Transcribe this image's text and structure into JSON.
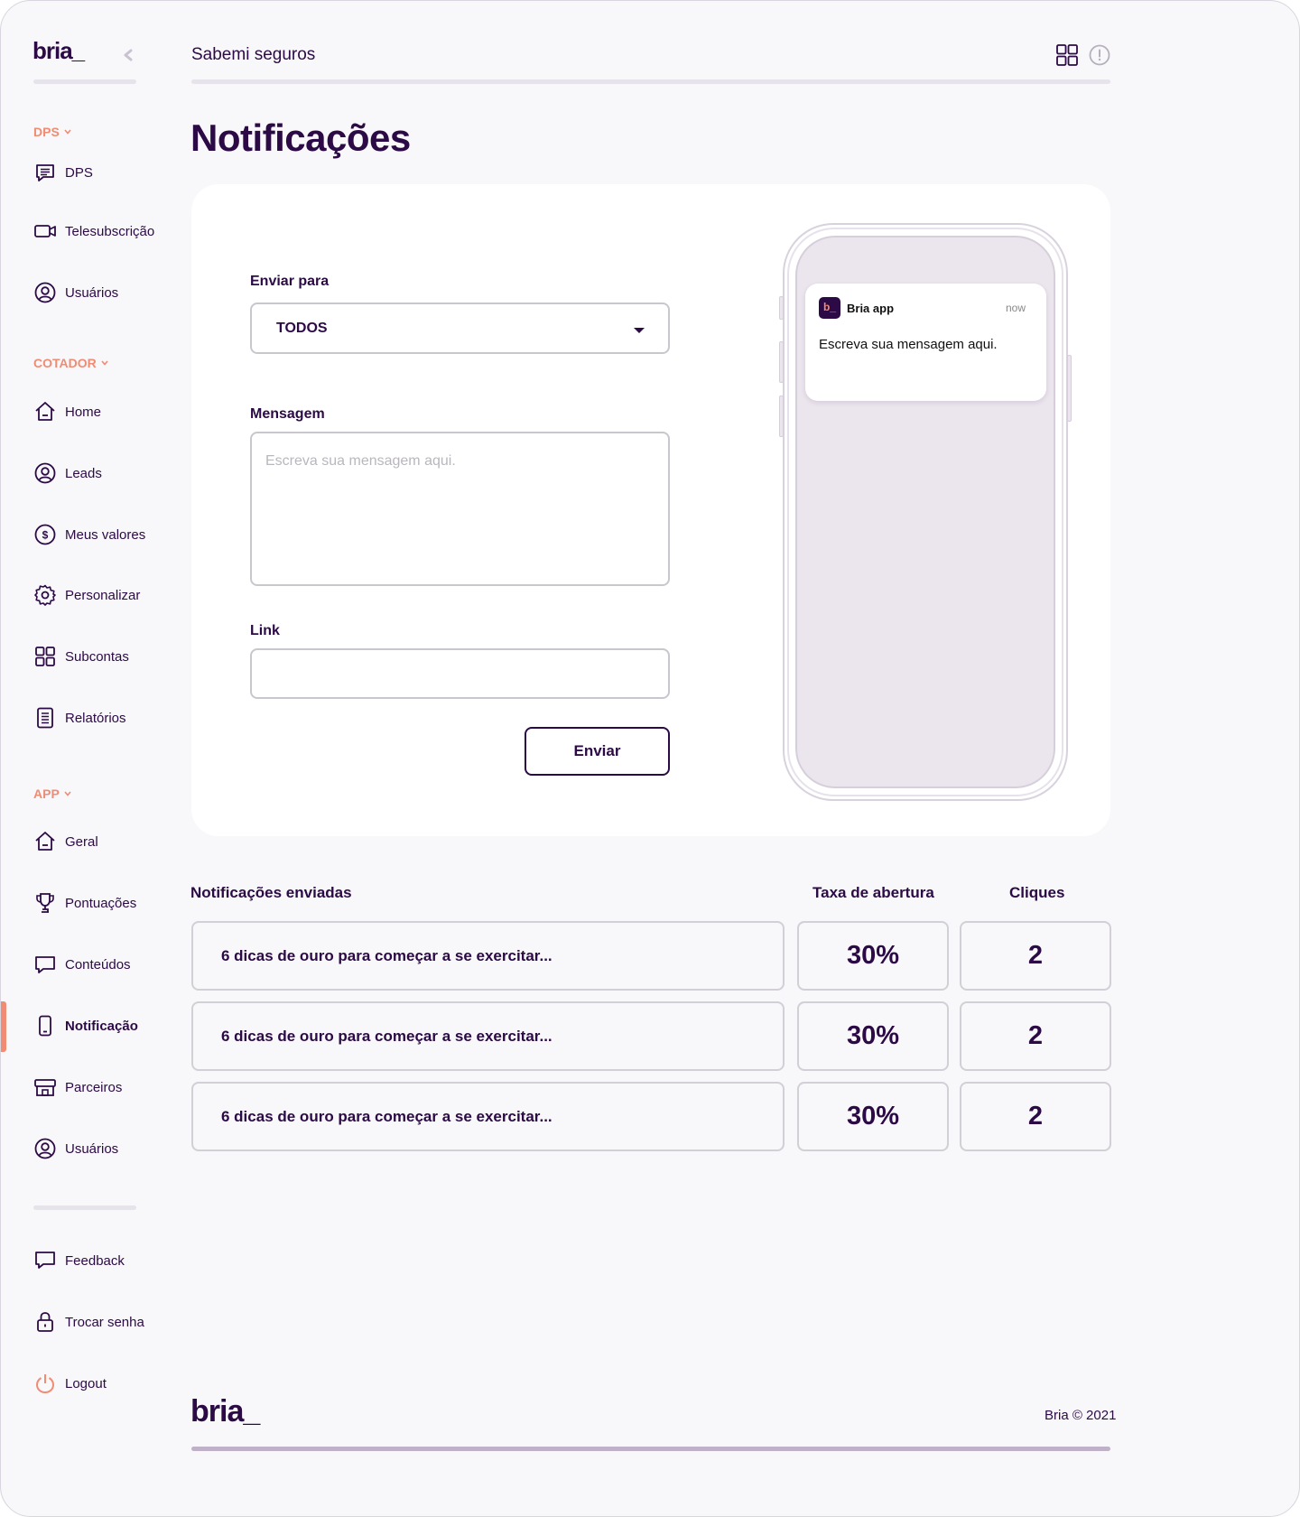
{
  "brand": {
    "logo": "bria_",
    "footer_logo": "bria_",
    "copyright": "Bria © 2021"
  },
  "colors": {
    "primary": "#2b0a45",
    "accent": "#f08c73",
    "background": "#f8f7fa",
    "card": "#ffffff"
  },
  "sidebar": {
    "sections": [
      {
        "title": "DPS",
        "items": [
          {
            "label": "DPS",
            "icon": "chat-lines-icon"
          },
          {
            "label": "Telesubscrição",
            "icon": "video-camera-icon"
          },
          {
            "label": "Usuários",
            "icon": "user-circle-icon"
          }
        ]
      },
      {
        "title": "COTADOR",
        "items": [
          {
            "label": "Home",
            "icon": "home-icon"
          },
          {
            "label": "Leads",
            "icon": "user-circle-icon"
          },
          {
            "label": "Meus valores",
            "icon": "dollar-circle-icon"
          },
          {
            "label": "Personalizar",
            "icon": "gear-icon"
          },
          {
            "label": "Subcontas",
            "icon": "grid-icon"
          },
          {
            "label": "Relatórios",
            "icon": "document-icon"
          }
        ]
      },
      {
        "title": "APP",
        "items": [
          {
            "label": "Geral",
            "icon": "home-icon"
          },
          {
            "label": "Pontuações",
            "icon": "trophy-icon"
          },
          {
            "label": "Conteúdos",
            "icon": "chat-bubble-icon"
          },
          {
            "label": "Notificação",
            "icon": "phone-icon",
            "active": true
          },
          {
            "label": "Parceiros",
            "icon": "store-icon"
          },
          {
            "label": "Usuários",
            "icon": "user-circle-icon"
          }
        ]
      }
    ],
    "bottom": [
      {
        "label": "Feedback",
        "icon": "feedback-icon"
      },
      {
        "label": "Trocar senha",
        "icon": "lock-icon"
      },
      {
        "label": "Logout",
        "icon": "power-icon"
      }
    ]
  },
  "header": {
    "breadcrumb": "Sabemi seguros"
  },
  "page": {
    "title": "Notificações"
  },
  "form": {
    "send_to_label": "Enviar para",
    "send_to_value": "TODOS",
    "message_label": "Mensagem",
    "message_placeholder": "Escreva sua mensagem aqui.",
    "link_label": "Link",
    "link_value": "",
    "submit_label": "Enviar"
  },
  "preview": {
    "app_name": "Bria app",
    "app_icon": "b_",
    "time": "now",
    "message": "Escreva sua mensagem aqui."
  },
  "sent": {
    "headers": {
      "message": "Notificações enviadas",
      "open_rate": "Taxa de abertura",
      "clicks": "Cliques"
    },
    "rows": [
      {
        "message": "6 dicas de ouro para começar a se exercitar...",
        "open_rate": "30%",
        "clicks": "2"
      },
      {
        "message": "6 dicas de ouro para começar a se exercitar...",
        "open_rate": "30%",
        "clicks": "2"
      },
      {
        "message": "6 dicas de ouro para começar a se exercitar...",
        "open_rate": "30%",
        "clicks": "2"
      }
    ]
  }
}
